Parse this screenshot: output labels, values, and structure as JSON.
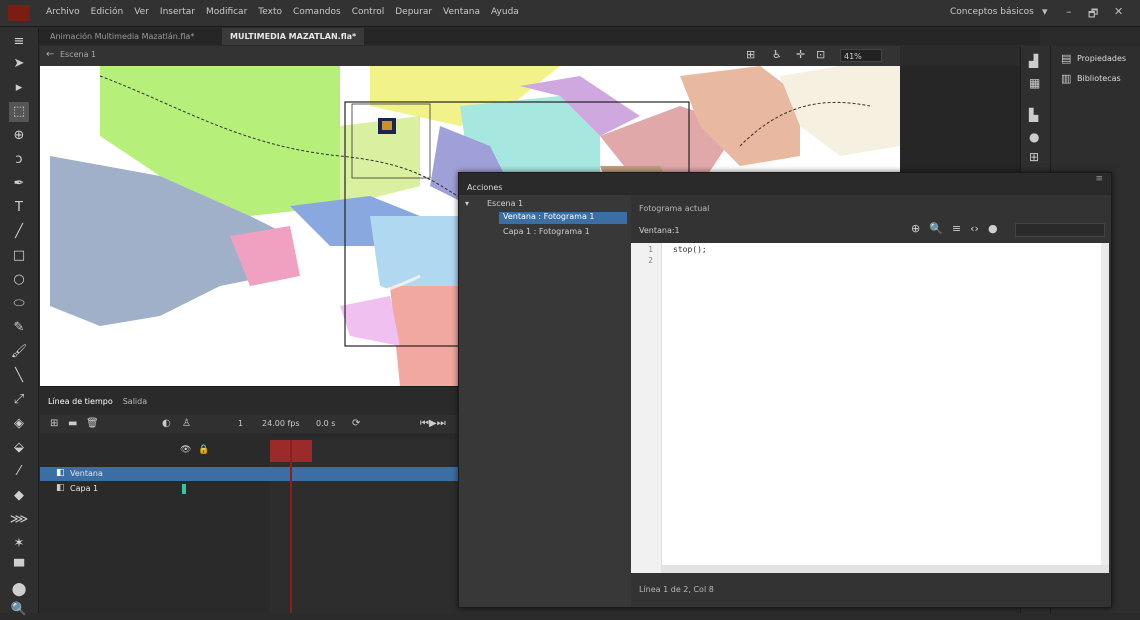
{
  "menu": {
    "items": [
      "Archivo",
      "Edición",
      "Ver",
      "Insertar",
      "Modificar",
      "Texto",
      "Comandos",
      "Control",
      "Depurar",
      "Ventana",
      "Ayuda"
    ],
    "workspace": "Conceptos básicos",
    "window_buttons": [
      "▾",
      "–",
      "🗗",
      "✕"
    ]
  },
  "tabs": [
    "Animación Multimedia Mazatlán.fla*",
    "MULTIMEDIA MAZATLAN.fla*"
  ],
  "editbar": {
    "scene": "Escena 1",
    "zoom": "41%"
  },
  "right_panel": {
    "items": [
      "Propiedades",
      "Bibliotecas"
    ]
  },
  "timeline": {
    "tabs": [
      "Línea de tiempo",
      "Salida"
    ],
    "frame_label": "1",
    "fps": "24.00 fps",
    "time": "0.0 s",
    "layers": [
      {
        "name": "Ventana",
        "selected": true
      },
      {
        "name": "Capa 1",
        "selected": false
      }
    ]
  },
  "actions": {
    "title": "Acciones",
    "tree": {
      "scene": "Escena 1",
      "items": [
        {
          "label": "Ventana : Fotograma 1",
          "selected": true
        },
        {
          "label": "Capa 1 : Fotograma 1",
          "selected": false
        }
      ]
    },
    "current_frame_label": "Fotograma actual",
    "location": "Ventana:1",
    "code_lines": [
      "stop();",
      ""
    ],
    "line_numbers": [
      "1",
      "2"
    ],
    "status": "Línea 1 de 2, Col 8"
  },
  "colors": {
    "accent": "#3b6fa3",
    "playhead": "#9b2a2a",
    "app": "#7a1d12"
  }
}
